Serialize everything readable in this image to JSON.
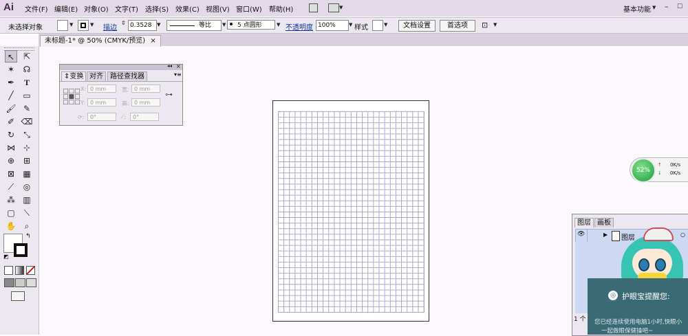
{
  "app": {
    "logo": "Ai",
    "workspace": "基本功能"
  },
  "menu": [
    "文件(F)",
    "编辑(E)",
    "对象(O)",
    "文字(T)",
    "选择(S)",
    "效果(C)",
    "视图(V)",
    "窗口(W)",
    "帮助(H)"
  ],
  "control": {
    "selection": "未选择对象",
    "stroke_label": "描边",
    "stroke_value": "0.3528",
    "profile": "等比",
    "brush": "5 点圆形",
    "opacity_label": "不透明度",
    "opacity_value": "100%",
    "style_label": "样式",
    "doc_setup": "文档设置",
    "prefs": "首选项"
  },
  "document": {
    "tab": "未标题-1* @ 50% (CMYK/预览)"
  },
  "transform_panel": {
    "tabs": [
      "变换",
      "对齐",
      "路径查找器"
    ],
    "x_label": "X:",
    "x": "0 mm",
    "y_label": "Y:",
    "y": "0 mm",
    "w_label": "宽:",
    "w": "0 mm",
    "h_label": "高:",
    "h": "0 mm",
    "rotate": "0°",
    "shear": "0°"
  },
  "net_widget": {
    "percent": "52%",
    "up": "0K/s",
    "down": "0K/s"
  },
  "layers_panel": {
    "tabs": [
      "图层",
      "画板"
    ],
    "layer_name": "图层",
    "footer": "1 个"
  },
  "reminder": {
    "title": "护眼宝提醒您:",
    "message": "您已经连续使用电脑1小时,快眼小",
    "message2": "一起做眼保健操吧~"
  },
  "colors": {
    "menubar": "#e2dbe7",
    "panel": "#ece8ef",
    "grid": "#a9a4cf",
    "reminder": "#3a6a75",
    "ball": "#1f9e40"
  }
}
